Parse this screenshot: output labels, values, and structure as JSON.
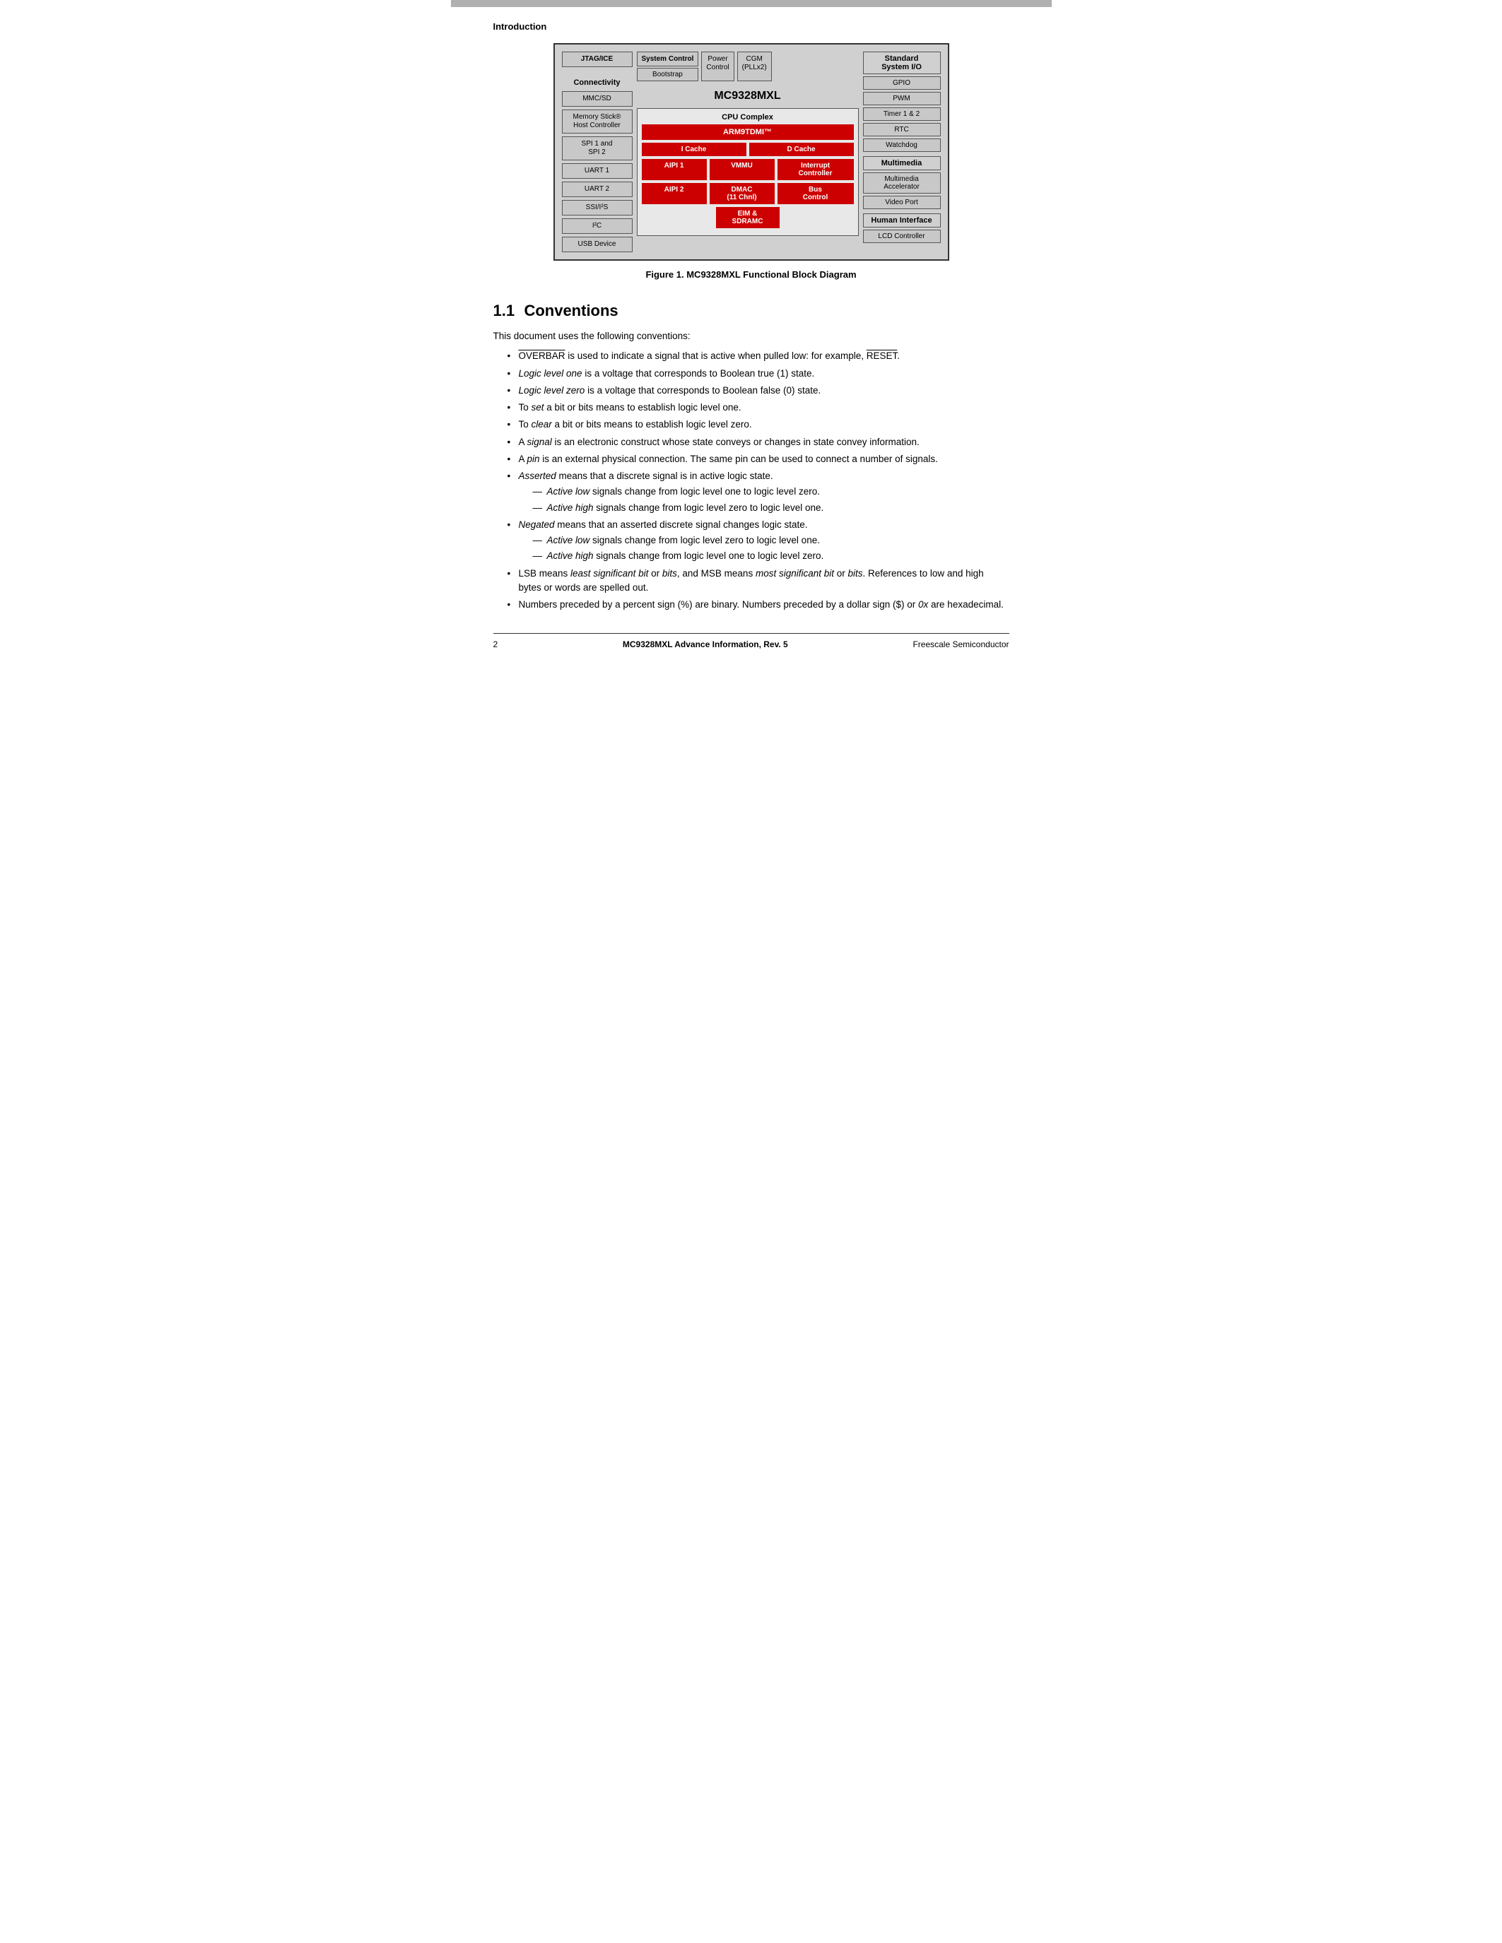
{
  "page": {
    "top_bar_color": "#a0a0a0",
    "section_label": "Introduction",
    "figure_caption": "Figure 1.   MC9328MXL Functional Block Diagram",
    "section_number": "1.1",
    "section_title": "Conventions",
    "intro_text": "This document uses the following conventions:"
  },
  "diagram": {
    "chip_name": "MC9328MXL",
    "left_header": "Connectivity",
    "left_boxes": [
      "MMC/SD",
      "Memory Stick®\nHost Controller",
      "SPI 1 and\nSPI 2",
      "UART 1",
      "UART 2",
      "SSI/I²S",
      "I²C",
      "USB Device"
    ],
    "top_left_box": "JTAG/ICE",
    "sys_ctrl_header": "System Control",
    "bootstrap_label": "Bootstrap",
    "power_label1": "Power",
    "power_label2": "Control",
    "cgm_label1": "CGM",
    "cgm_label2": "(PLLx2)",
    "cpu_header": "CPU Complex",
    "arm_label": "ARM9TDMI™",
    "icache_label": "I Cache",
    "dcache_label": "D Cache",
    "aipi1_label": "AIPI 1",
    "vmmu_label": "VMMU",
    "interrupt_label1": "Interrupt",
    "interrupt_label2": "Controller",
    "aipi2_label": "AIPI 2",
    "dmac_label1": "DMAC",
    "dmac_label2": "(11 Chnl)",
    "bus_label1": "Bus",
    "bus_label2": "Control",
    "eim_label1": "EIM &",
    "eim_label2": "SDRAMC",
    "right_std_header": "Standard\nSystem I/O",
    "gpio_label": "GPIO",
    "pwm_label": "PWM",
    "timer_label": "Timer 1 & 2",
    "rtc_label": "RTC",
    "watchdog_label": "Watchdog",
    "multimedia_header": "Multimedia",
    "multimedia_accel_label": "Multimedia\nAccelerator",
    "video_port_label": "Video Port",
    "human_if_header": "Human Interface",
    "lcd_label": "LCD Controller"
  },
  "bullets": [
    {
      "text_parts": [
        {
          "type": "overbar",
          "text": "OVERBAR"
        },
        {
          "type": "normal",
          "text": " is used to indicate a signal that is active when pulled low: for example, "
        },
        {
          "type": "overbar",
          "text": "RESET"
        },
        {
          "type": "normal",
          "text": "."
        }
      ],
      "sub": []
    },
    {
      "text_parts": [
        {
          "type": "italic",
          "text": "Logic level one"
        },
        {
          "type": "normal",
          "text": " is a voltage that corresponds to Boolean true (1) state."
        }
      ],
      "sub": []
    },
    {
      "text_parts": [
        {
          "type": "italic",
          "text": "Logic level zero"
        },
        {
          "type": "normal",
          "text": " is a voltage that corresponds to Boolean false (0) state."
        }
      ],
      "sub": []
    },
    {
      "text_parts": [
        {
          "type": "normal",
          "text": "To "
        },
        {
          "type": "italic",
          "text": "set"
        },
        {
          "type": "normal",
          "text": " a bit or bits means to establish logic level one."
        }
      ],
      "sub": []
    },
    {
      "text_parts": [
        {
          "type": "normal",
          "text": "To "
        },
        {
          "type": "italic",
          "text": "clear"
        },
        {
          "type": "normal",
          "text": " a bit or bits means to establish logic level zero."
        }
      ],
      "sub": []
    },
    {
      "text_parts": [
        {
          "type": "normal",
          "text": "A "
        },
        {
          "type": "italic",
          "text": "signal"
        },
        {
          "type": "normal",
          "text": " is an electronic construct whose state conveys or changes in state convey information."
        }
      ],
      "sub": []
    },
    {
      "text_parts": [
        {
          "type": "normal",
          "text": "A "
        },
        {
          "type": "italic",
          "text": "pin"
        },
        {
          "type": "normal",
          "text": " is an external physical connection. The same pin can be used to connect a number of signals."
        }
      ],
      "sub": []
    },
    {
      "text_parts": [
        {
          "type": "italic",
          "text": "Asserted"
        },
        {
          "type": "normal",
          "text": " means that a discrete signal is in active logic state."
        }
      ],
      "sub": [
        [
          {
            "type": "italic",
            "text": "Active low"
          },
          {
            "type": "normal",
            "text": " signals change from logic level one to logic level zero."
          }
        ],
        [
          {
            "type": "italic",
            "text": "Active high"
          },
          {
            "type": "normal",
            "text": " signals change from logic level zero to logic level one."
          }
        ]
      ]
    },
    {
      "text_parts": [
        {
          "type": "italic",
          "text": "Negated"
        },
        {
          "type": "normal",
          "text": " means that an asserted discrete signal changes logic state."
        }
      ],
      "sub": [
        [
          {
            "type": "italic",
            "text": "Active low"
          },
          {
            "type": "normal",
            "text": " signals change from logic level zero to logic level one."
          }
        ],
        [
          {
            "type": "italic",
            "text": "Active high"
          },
          {
            "type": "normal",
            "text": " signals change from logic level one to logic level zero."
          }
        ]
      ]
    },
    {
      "text_parts": [
        {
          "type": "normal",
          "text": "LSB means "
        },
        {
          "type": "italic",
          "text": "least significant bit"
        },
        {
          "type": "normal",
          "text": " or "
        },
        {
          "type": "italic",
          "text": "bits"
        },
        {
          "type": "normal",
          "text": ", and MSB means "
        },
        {
          "type": "italic",
          "text": "most significant bit"
        },
        {
          "type": "normal",
          "text": " or "
        },
        {
          "type": "italic",
          "text": "bits"
        },
        {
          "type": "normal",
          "text": ". References to low and high bytes or words are spelled out."
        }
      ],
      "sub": []
    },
    {
      "text_parts": [
        {
          "type": "normal",
          "text": "Numbers preceded by a percent sign (%) are binary. Numbers preceded by a dollar sign ($) or "
        },
        {
          "type": "italic",
          "text": "0x"
        },
        {
          "type": "normal",
          "text": " are hexadecimal."
        }
      ],
      "sub": []
    }
  ],
  "footer": {
    "page_number": "2",
    "center_text": "MC9328MXL Advance Information, Rev. 5",
    "right_text": "Freescale Semiconductor"
  }
}
